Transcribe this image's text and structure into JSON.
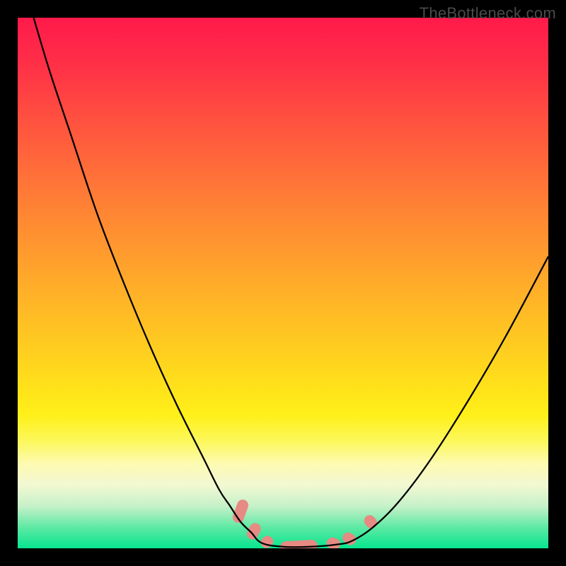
{
  "watermark": "TheBottleneck.com",
  "chart_data": {
    "type": "line",
    "title": "",
    "xlabel": "",
    "ylabel": "",
    "xlim": [
      0,
      100
    ],
    "ylim": [
      0,
      100
    ],
    "series": [
      {
        "name": "left-curve",
        "x": [
          3,
          6,
          10,
          15,
          20,
          25,
          30,
          35,
          38,
          40,
          42,
          44,
          46
        ],
        "y": [
          100,
          90,
          78,
          63,
          50,
          38,
          27,
          17,
          11,
          8,
          5,
          3,
          1
        ]
      },
      {
        "name": "valley-floor",
        "x": [
          46,
          50,
          55,
          60,
          63
        ],
        "y": [
          1,
          0.3,
          0.3,
          0.7,
          1.4
        ]
      },
      {
        "name": "right-curve",
        "x": [
          63,
          67,
          72,
          78,
          85,
          92,
          100
        ],
        "y": [
          1.4,
          4,
          9,
          17,
          28,
          40,
          55
        ]
      }
    ],
    "markers": [
      {
        "name": "left-marker-1",
        "x": 42,
        "y": 7,
        "len": 4.5,
        "angle": -70
      },
      {
        "name": "left-marker-2",
        "x": 44.5,
        "y": 3.2,
        "len": 3.2,
        "angle": -62
      },
      {
        "name": "floor-marker-1",
        "x": 47,
        "y": 1.2,
        "len": 2.4,
        "angle": -40
      },
      {
        "name": "floor-marker-2",
        "x": 53,
        "y": 0.4,
        "len": 7.0,
        "angle": -3
      },
      {
        "name": "floor-marker-3",
        "x": 59.5,
        "y": 0.9,
        "len": 2.6,
        "angle": 15
      },
      {
        "name": "right-marker-1",
        "x": 62.5,
        "y": 1.8,
        "len": 2.6,
        "angle": 35
      },
      {
        "name": "right-marker-2",
        "x": 66.5,
        "y": 5.0,
        "len": 2.6,
        "angle": 50
      }
    ],
    "colors": {
      "curve": "#000000",
      "marker": "#e78a83",
      "gradient_top": "#ff1a4b",
      "gradient_mid": "#ffe21a",
      "gradient_bottom": "#07e58f",
      "frame": "#000000"
    }
  }
}
